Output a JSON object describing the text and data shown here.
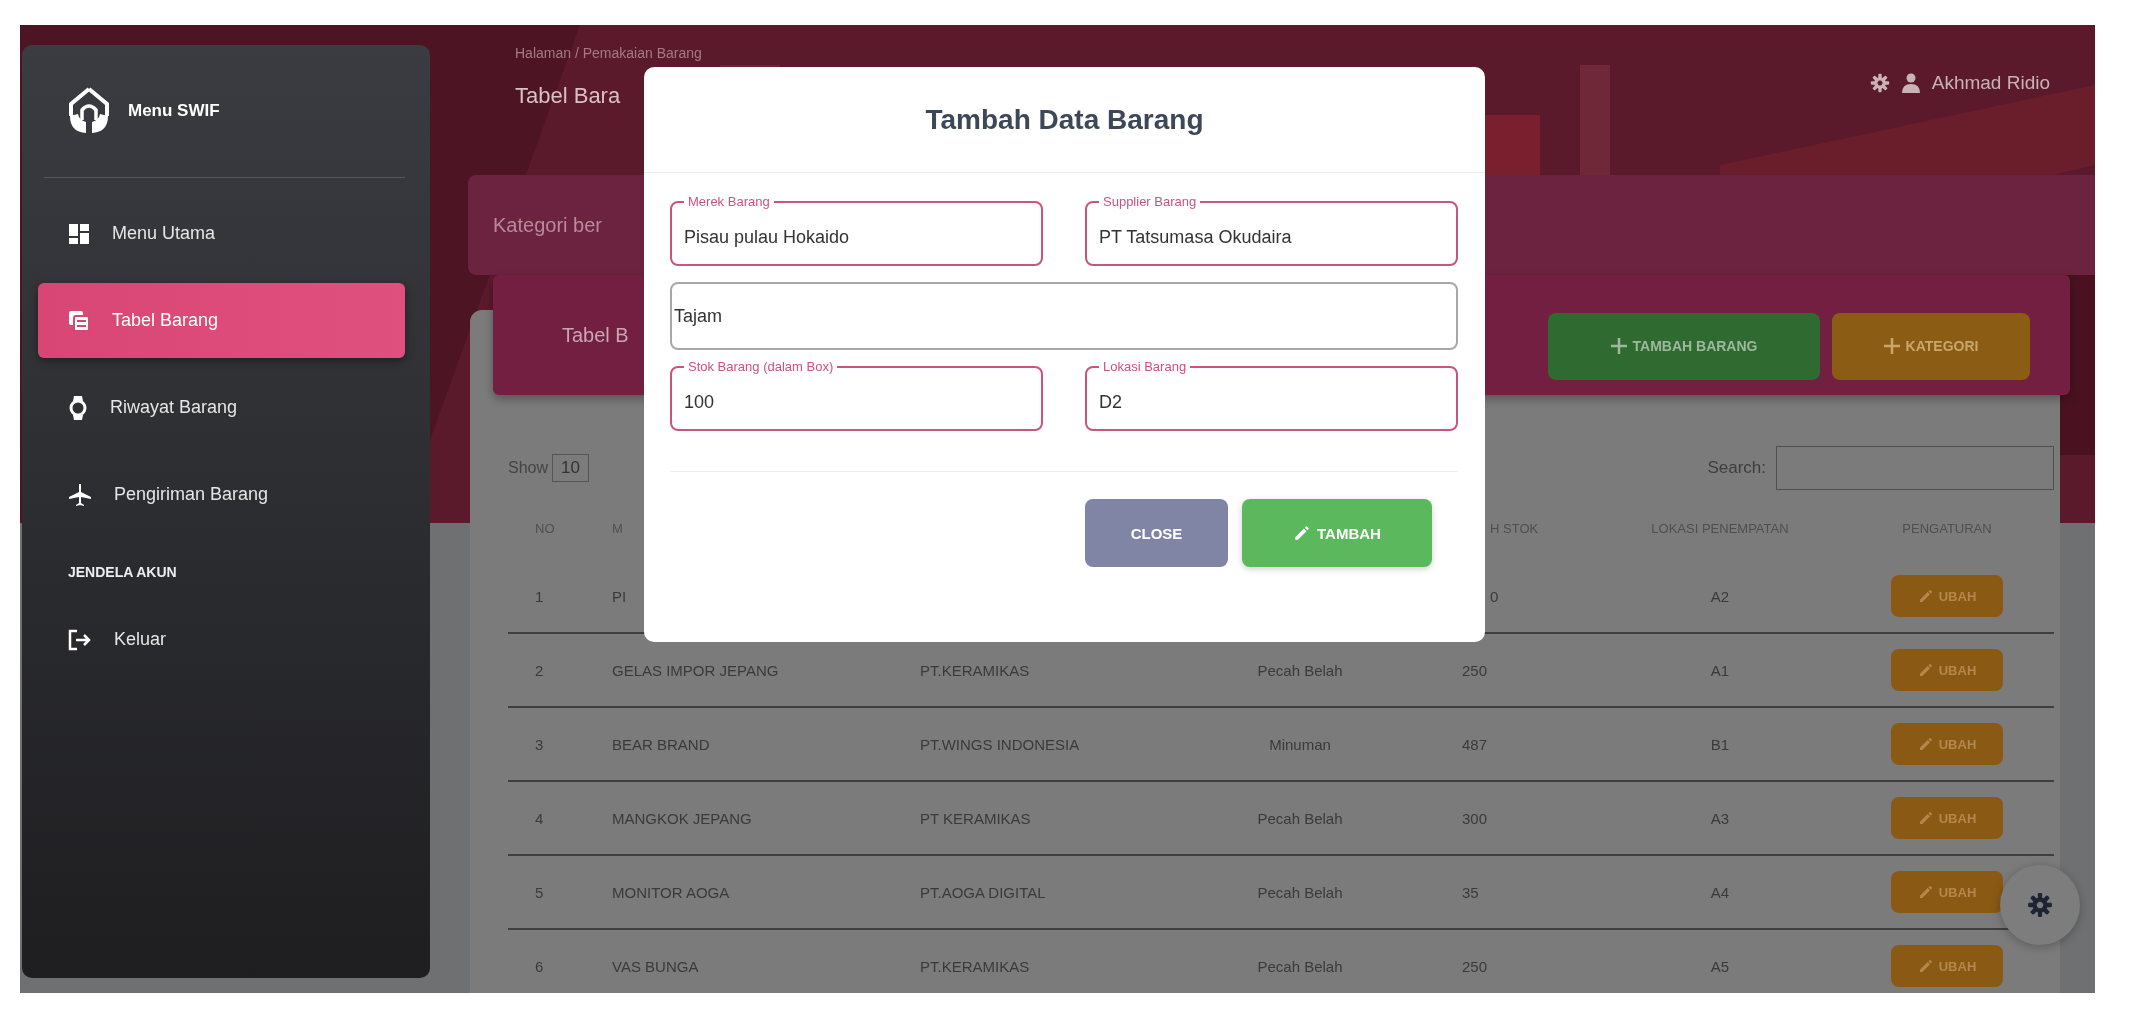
{
  "sidebar": {
    "brand": "Menu SWIF",
    "items": [
      {
        "label": "Menu Utama",
        "selected": false
      },
      {
        "label": "Tabel Barang",
        "selected": true
      },
      {
        "label": "Riwayat Barang",
        "selected": false
      },
      {
        "label": "Pengiriman Barang",
        "selected": false
      }
    ],
    "section": "JENDELA AKUN",
    "account_items": [
      {
        "label": "Keluar",
        "selected": false
      }
    ]
  },
  "header": {
    "breadcrumb": "Halaman / Pemakaian Barang",
    "title": "Tabel Bara",
    "user": "Akhmad Ridio"
  },
  "category_bar": {
    "text": "Kategori ber"
  },
  "card": {
    "title": "Tabel B",
    "buttons": [
      {
        "label": "TAMBAH BARANG",
        "kind": "add"
      },
      {
        "label": "KATEGORI",
        "kind": "category"
      }
    ]
  },
  "table": {
    "show_label": "Show",
    "page_size": "10",
    "search_label": "Search:",
    "columns": {
      "column_1": "NO",
      "column_2": "M",
      "column_5": "H STOK",
      "column_6": "LOKASI PENEMPATAN",
      "column_7": "PENGATURAN"
    },
    "rows": [
      {
        "column_1": "1",
        "column_2": "PI",
        "column_5": "0",
        "column_6": "A2",
        "column_7": "UBAH"
      },
      {
        "column_1": "2",
        "column_2": "GELAS IMPOR JEPANG",
        "column_3": "PT.KERAMIKAS",
        "column_4": "Pecah Belah",
        "column_5": "250",
        "column_6": "A1",
        "column_7": "UBAH"
      },
      {
        "column_1": "3",
        "column_2": "BEAR BRAND",
        "column_3": "PT.WINGS INDONESIA",
        "column_4": "Minuman",
        "column_5": "487",
        "column_6": "B1",
        "column_7": "UBAH"
      },
      {
        "column_1": "4",
        "column_2": "MANGKOK JEPANG",
        "column_3": "PT KERAMIKAS",
        "column_4": "Pecah Belah",
        "column_5": "300",
        "column_6": "A3",
        "column_7": "UBAH"
      },
      {
        "column_1": "5",
        "column_2": "MONITOR AOGA",
        "column_3": "PT.AOGA DIGITAL",
        "column_4": "Pecah Belah",
        "column_5": "35",
        "column_6": "A4",
        "column_7": "UBAH"
      },
      {
        "column_1": "6",
        "column_2": "VAS BUNGA",
        "column_3": "PT.KERAMIKAS",
        "column_4": "Pecah Belah",
        "column_5": "250",
        "column_6": "A5",
        "column_7": "UBAH"
      }
    ]
  },
  "modal": {
    "title": "Tambah Data Barang",
    "fields": [
      {
        "kind": "labeled",
        "label": "Merek Barang",
        "value": "Pisau pulau Hokaido"
      },
      {
        "kind": "labeled",
        "label": "Supplier Barang",
        "value": "PT Tatsumasa Okudaira"
      },
      {
        "kind": "plain",
        "value": "Tajam"
      },
      {
        "kind": "labeled",
        "label": "Stok Barang (dalam Box)",
        "value": "100"
      },
      {
        "kind": "labeled",
        "label": "Lokasi Barang",
        "value": "D2"
      }
    ],
    "buttons": [
      {
        "label": "CLOSE",
        "kind": "close"
      },
      {
        "label": "TAMBAH",
        "kind": "submit"
      }
    ]
  }
}
